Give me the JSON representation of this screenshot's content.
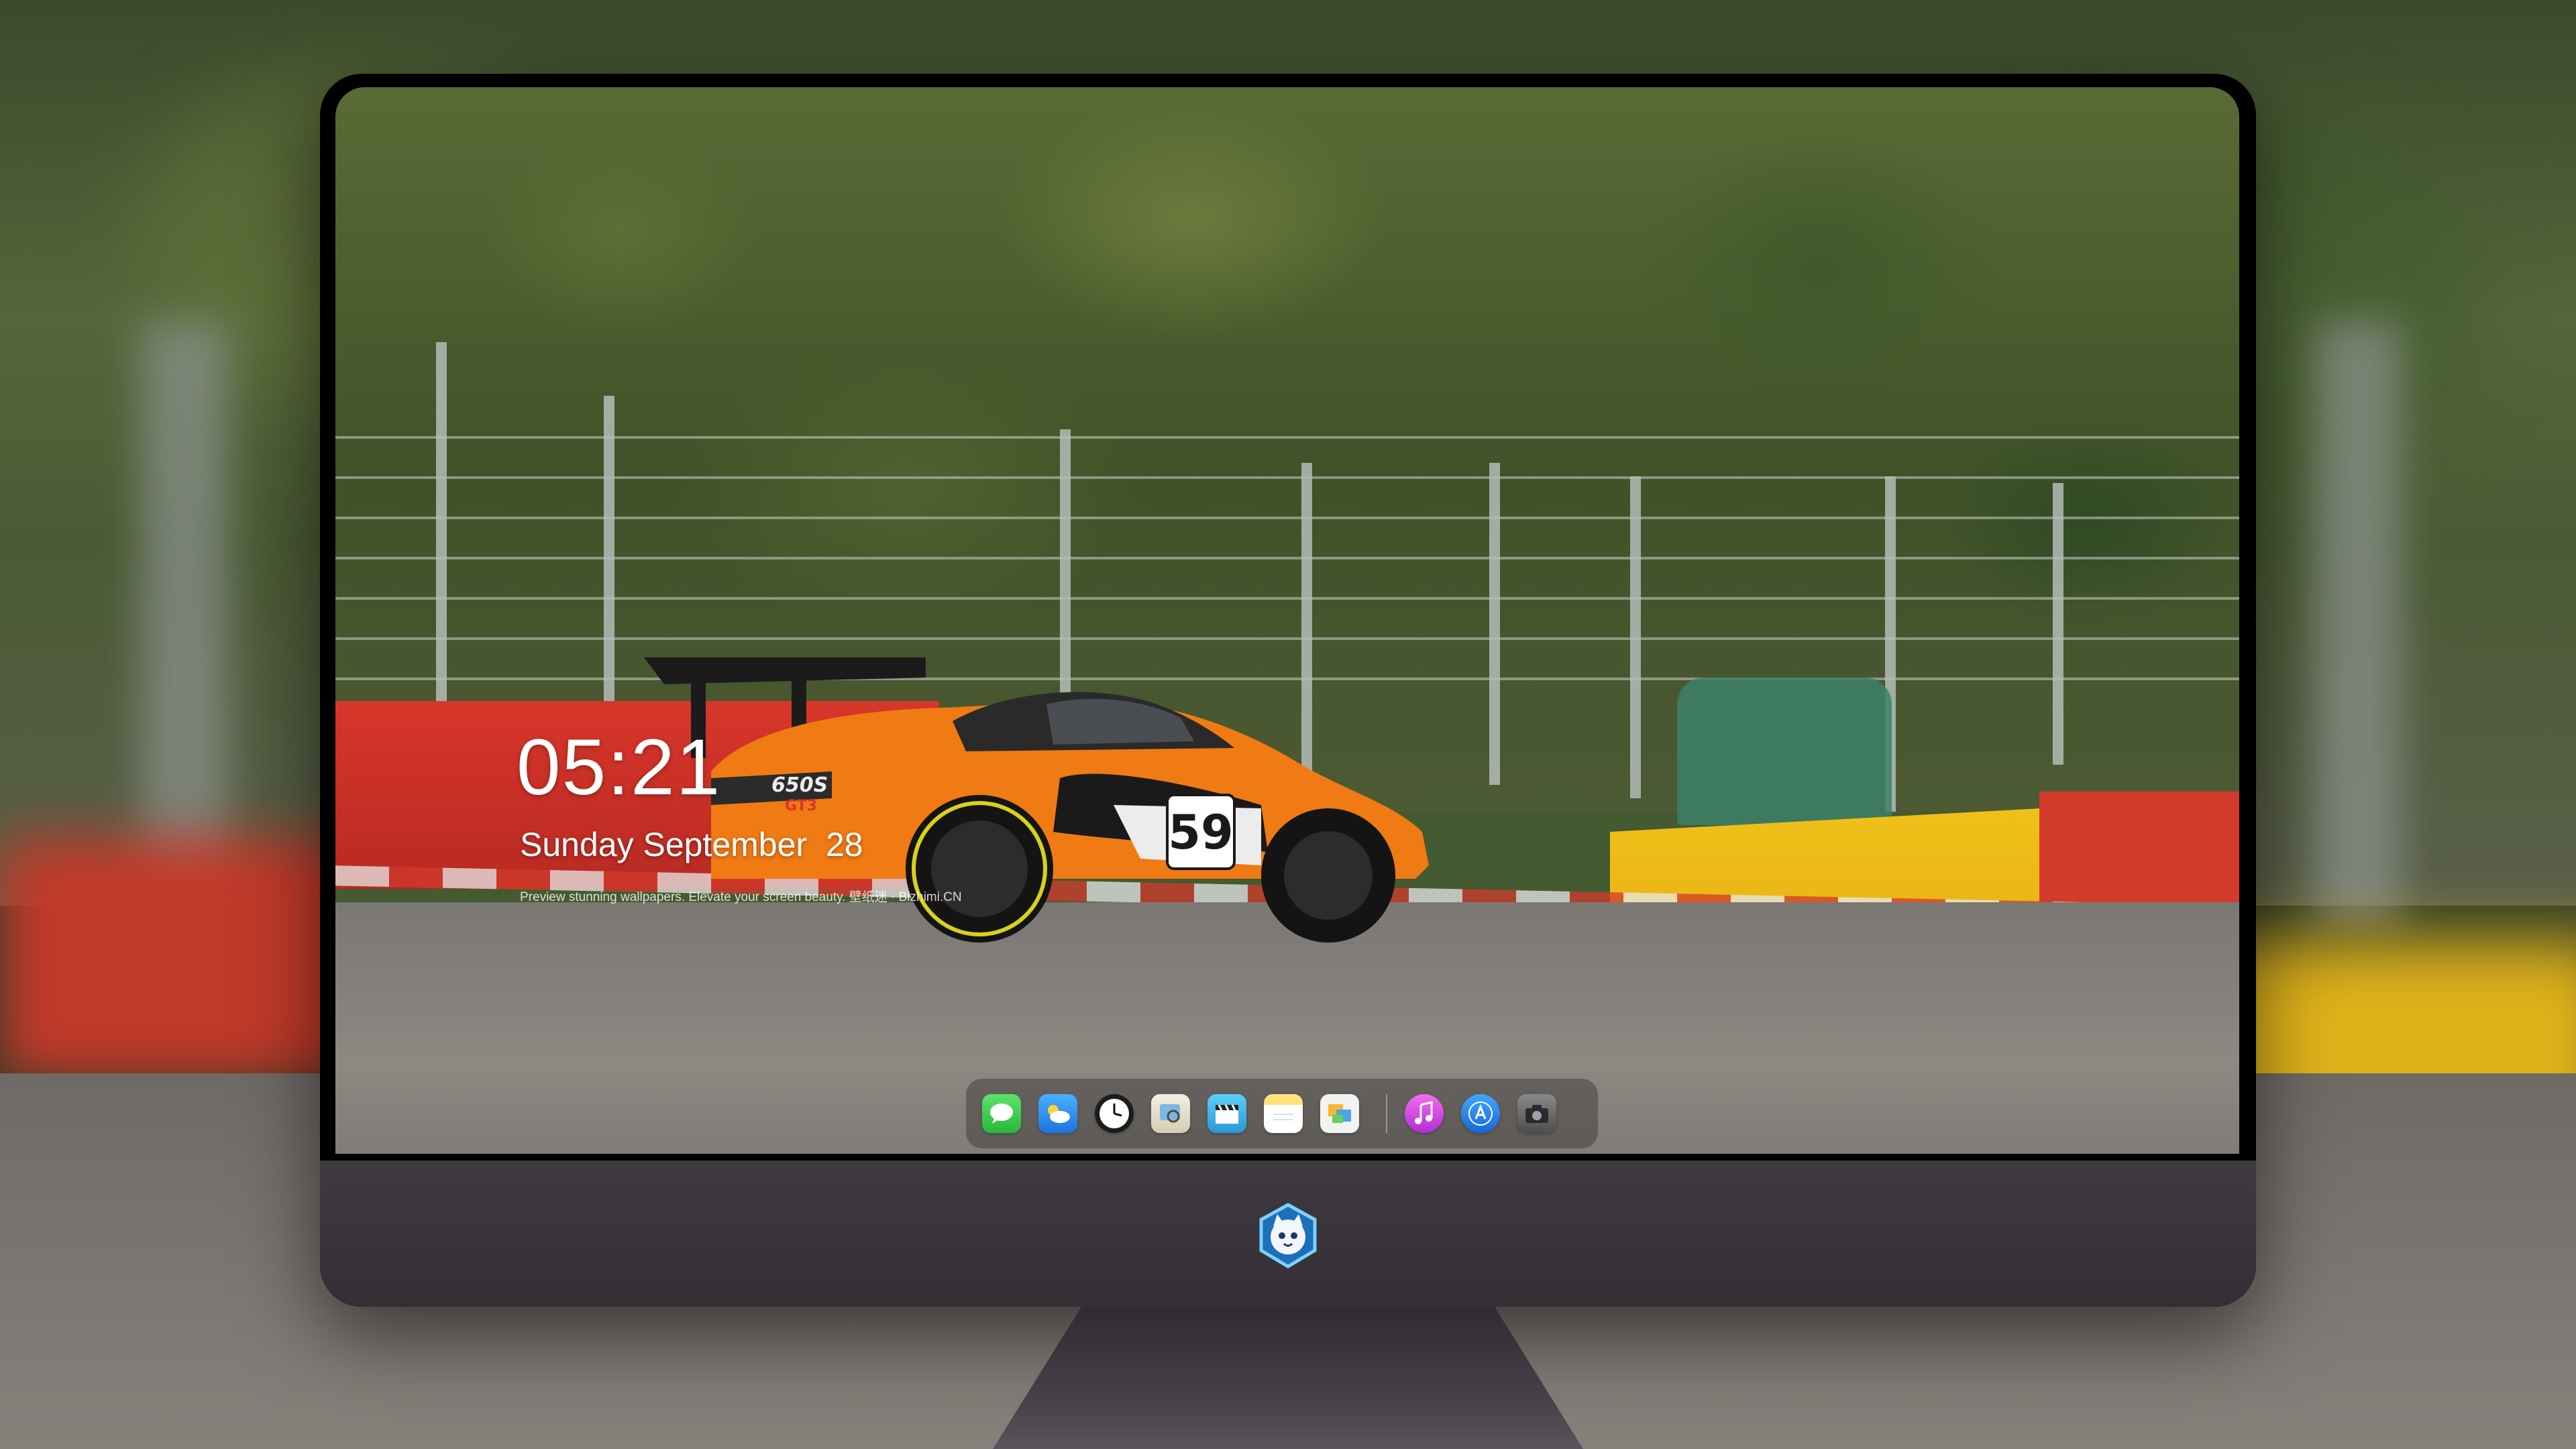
{
  "lockscreen": {
    "time": "05:21",
    "date": "Sunday September  28",
    "tagline": "Preview stunning wallpapers. Elevate your screen beauty. 壁纸迷 · Bizhimi.CN"
  },
  "wallpaper": {
    "car_number": "59",
    "car_model_badge": "650S",
    "car_trim_badge": "GT3"
  },
  "dock": {
    "apps": [
      {
        "name": "messages-icon",
        "color": "#3fd44d"
      },
      {
        "name": "weather-icon",
        "color": "#2f8ff5"
      },
      {
        "name": "clock-icon",
        "color": "#1c1c1c"
      },
      {
        "name": "preview-icon",
        "color": "#e9e3d3"
      },
      {
        "name": "clapper-icon",
        "color": "#37b8e8"
      },
      {
        "name": "notes-icon",
        "color": "#fddb4e"
      },
      {
        "name": "photos-icon",
        "color": "#e8e8e8"
      },
      {
        "name": "music-icon",
        "color": "#e94ad7"
      },
      {
        "name": "app-store-icon",
        "color": "#2f8ff5"
      },
      {
        "name": "camera-icon",
        "color": "#6b6b6b"
      }
    ]
  },
  "colors": {
    "car_orange": "#f07a14",
    "wall_red": "#d8362a",
    "wall_yellow": "#f0c21a",
    "bezel": "#3a363b"
  }
}
